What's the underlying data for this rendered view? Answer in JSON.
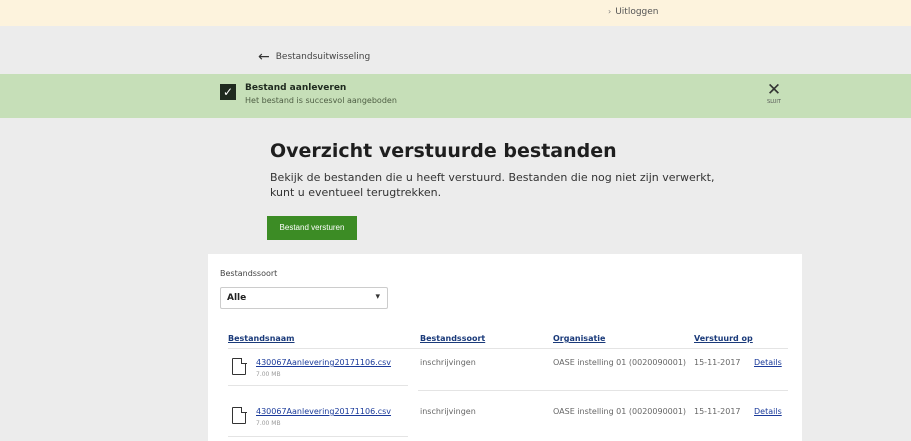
{
  "topbar": {
    "logout_label": "Uitloggen"
  },
  "nav": {
    "back_label": "Bestandsuitwisseling"
  },
  "notice": {
    "title": "Bestand aanleveren",
    "subtitle": "Het bestand is succesvol aangeboden",
    "close_label": "SLUIT"
  },
  "page": {
    "title": "Overzicht verstuurde bestanden",
    "intro": "Bekijk de bestanden die u heeft verstuurd. Bestanden die nog niet zijn verwerkt, kunt u eventueel terugtrekken.",
    "send_button": "Bestand versturen"
  },
  "filter": {
    "label": "Bestandssoort",
    "selected": "Alle"
  },
  "table": {
    "headers": [
      "Bestandsnaam",
      "Bestandssoort",
      "Organisatie",
      "Verstuurd op"
    ],
    "rows": [
      {
        "filename": "430067Aanlevering20171106.csv",
        "size": "7.00 MB",
        "type": "inschrijvingen",
        "organisation": "OASE instelling 01 (0020090001)",
        "date": "15-11-2017",
        "action": "Details"
      },
      {
        "filename": "430067Aanlevering20171106.csv",
        "size": "7.00 MB",
        "type": "inschrijvingen",
        "organisation": "OASE instelling 01 (0020090001)",
        "date": "15-11-2017",
        "action": "Details"
      }
    ]
  }
}
